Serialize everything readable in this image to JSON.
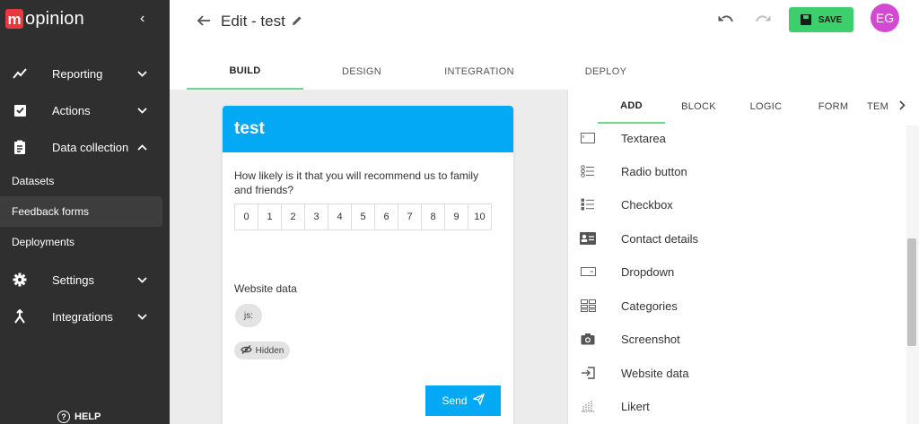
{
  "brand": {
    "logo_mark": "m",
    "logo_rest": "opinion"
  },
  "sidebar": {
    "collapse_icon": "chevron-left-icon",
    "items": [
      {
        "label": "Reporting",
        "icon": "trend-icon",
        "expanded": false
      },
      {
        "label": "Actions",
        "icon": "checklist-icon",
        "expanded": false
      },
      {
        "label": "Data collection",
        "icon": "clipboard-icon",
        "expanded": true
      },
      {
        "label": "Settings",
        "icon": "gear-icon",
        "expanded": false
      },
      {
        "label": "Integrations",
        "icon": "merge-icon",
        "expanded": false
      }
    ],
    "sub_items": [
      {
        "label": "Datasets",
        "active": false
      },
      {
        "label": "Feedback forms",
        "active": true
      },
      {
        "label": "Deployments",
        "active": false
      }
    ],
    "help_label": "HELP"
  },
  "header": {
    "title": "Edit - test",
    "save_label": "SAVE",
    "avatar_initials": "EG",
    "tabs": [
      {
        "label": "BUILD",
        "active": true
      },
      {
        "label": "DESIGN",
        "active": false
      },
      {
        "label": "INTEGRATION",
        "active": false
      },
      {
        "label": "DEPLOY",
        "active": false
      }
    ]
  },
  "form_preview": {
    "title": "test",
    "question": "How likely is it that you will recommend us to family and friends?",
    "scale": [
      "0",
      "1",
      "2",
      "3",
      "4",
      "5",
      "6",
      "7",
      "8",
      "9",
      "10"
    ],
    "website_data_label": "Website data",
    "chip_label": "js:",
    "hidden_label": "Hidden",
    "send_label": "Send"
  },
  "panel": {
    "tabs": [
      {
        "label": "ADD",
        "active": true
      },
      {
        "label": "BLOCK",
        "active": false
      },
      {
        "label": "LOGIC",
        "active": false
      },
      {
        "label": "FORM",
        "active": false
      },
      {
        "label": "TEM",
        "active": false
      }
    ],
    "items": [
      {
        "label": "Textarea",
        "icon": "textarea-icon"
      },
      {
        "label": "Radio button",
        "icon": "radio-list-icon"
      },
      {
        "label": "Checkbox",
        "icon": "checkbox-list-icon"
      },
      {
        "label": "Contact details",
        "icon": "contact-card-icon"
      },
      {
        "label": "Dropdown",
        "icon": "dropdown-icon"
      },
      {
        "label": "Categories",
        "icon": "categories-icon"
      },
      {
        "label": "Screenshot",
        "icon": "camera-icon"
      },
      {
        "label": "Website data",
        "icon": "login-icon"
      },
      {
        "label": "Likert",
        "icon": "likert-icon"
      }
    ]
  },
  "colors": {
    "sidebar": "#2f2f2f",
    "accent_blue": "#03a9f4",
    "save_green": "#3ccf6c",
    "avatar": "#d14ad1",
    "logo_red": "#e8383d"
  }
}
